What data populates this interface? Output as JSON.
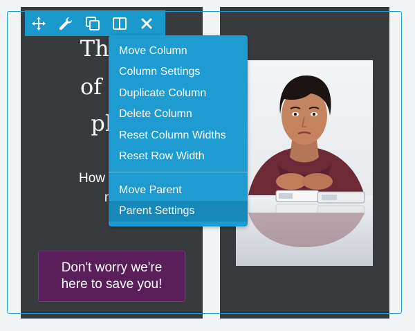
{
  "left_column": {
    "heading_line1": "The d",
    "heading_line2": "of a b",
    "heading_line3": "pho",
    "body_line1": "How can I f",
    "body_line2": "no",
    "cta_line1": "Don't worry we're",
    "cta_line2": "here to save you!"
  },
  "toolbar": {
    "icons": [
      "move-icon",
      "wrench-icon",
      "duplicate-icon",
      "columns-icon",
      "close-icon"
    ]
  },
  "context_menu": {
    "items": [
      "Move Column",
      "Column Settings",
      "Duplicate Column",
      "Delete Column",
      "Reset Column Widths",
      "Reset Row Width",
      "Move Parent",
      "Parent Settings"
    ],
    "active_item": "Parent Settings"
  },
  "colors": {
    "accent": "#1e9bd0",
    "column_bg": "#373b3d",
    "cta_bg": "#5a1f5a"
  }
}
